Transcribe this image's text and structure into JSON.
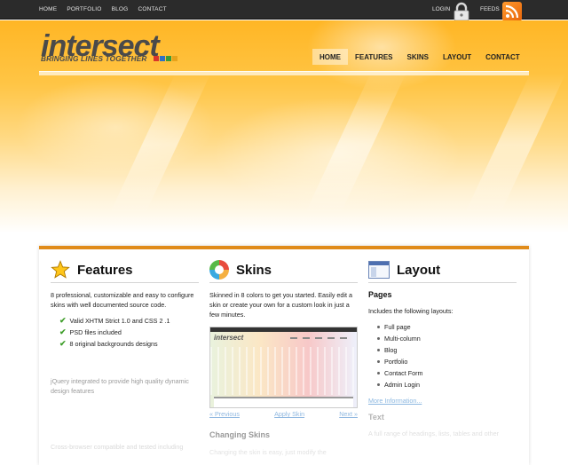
{
  "topbar": {
    "links": [
      "HOME",
      "PORTFOLIO",
      "BLOG",
      "CONTACT"
    ],
    "login": "LOGIN",
    "feeds": "FEEDS",
    "login_icon": "lock-icon",
    "feeds_icon": "rss-icon"
  },
  "brand": {
    "logo": "intersect",
    "tagline": "BRINGING LINES TOGETHER",
    "square_colors": [
      "#d9352b",
      "#2f6fc4",
      "#3c9a3a",
      "#e7a21b"
    ]
  },
  "mainnav": {
    "items": [
      "HOME",
      "FEATURES",
      "SKINS",
      "LAYOUT",
      "CONTACT"
    ],
    "active": "HOME"
  },
  "features": {
    "title": "Features",
    "icon": "star-icon",
    "intro": "8 professional, customizable and easy to configure skins with well documented source code.",
    "checks": [
      "Valid XHTM Strict 1.0 and CSS 2 .1",
      "PSD files included",
      "8 original backgrounds designs"
    ],
    "extra": "jQuery integrated to provide high quality dynamic design features",
    "faint": "Cross-browser compatible and tested including"
  },
  "skins": {
    "title": "Skins",
    "icon": "palette-icon",
    "intro": "Skinned in 8 colors to get you started. Easily edit a skin or create your own for a custom look in just a few minutes.",
    "preview_logo": "intersect",
    "prev": "« Previous",
    "apply": "Apply Skin",
    "next": "Next »",
    "sub_title": "Changing Skins",
    "sub_faint": "Changing the skin is easy, just modify the"
  },
  "layout": {
    "title": "Layout",
    "icon": "layout-icon",
    "pages_title": "Pages",
    "pages_intro": "Includes the following layouts:",
    "pages": [
      "Full page",
      "Multi-column",
      "Blog",
      "Portfolio",
      "Contact Form",
      "Admin Login"
    ],
    "more": "More Information...",
    "text_title": "Text",
    "text_faint": "A full range of headings, lists, tables and other"
  },
  "colors": {
    "accent": "#e08b1a",
    "topbar": "#2b2b2b",
    "check": "#3f9e2b",
    "link": "#6aa0d6"
  }
}
